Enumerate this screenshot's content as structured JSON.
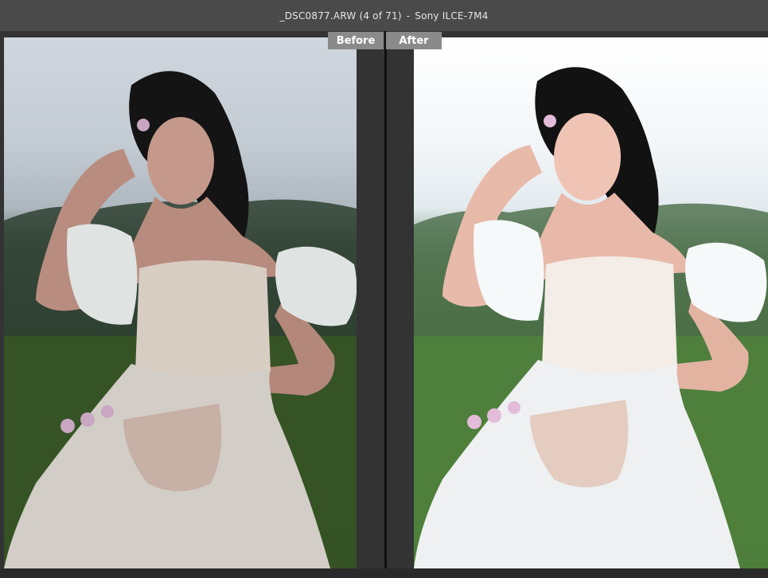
{
  "window": {
    "filename": "_DSC0877.ARW",
    "position": "(4 of 71)",
    "separator": "-",
    "camera": "Sony ILCE-7M4"
  },
  "compare": {
    "before_label": "Before",
    "after_label": "After"
  },
  "colors": {
    "titlebar_bg": "#4a4a4a",
    "tab_bg": "#8a8a8a",
    "divider": "#111111"
  }
}
